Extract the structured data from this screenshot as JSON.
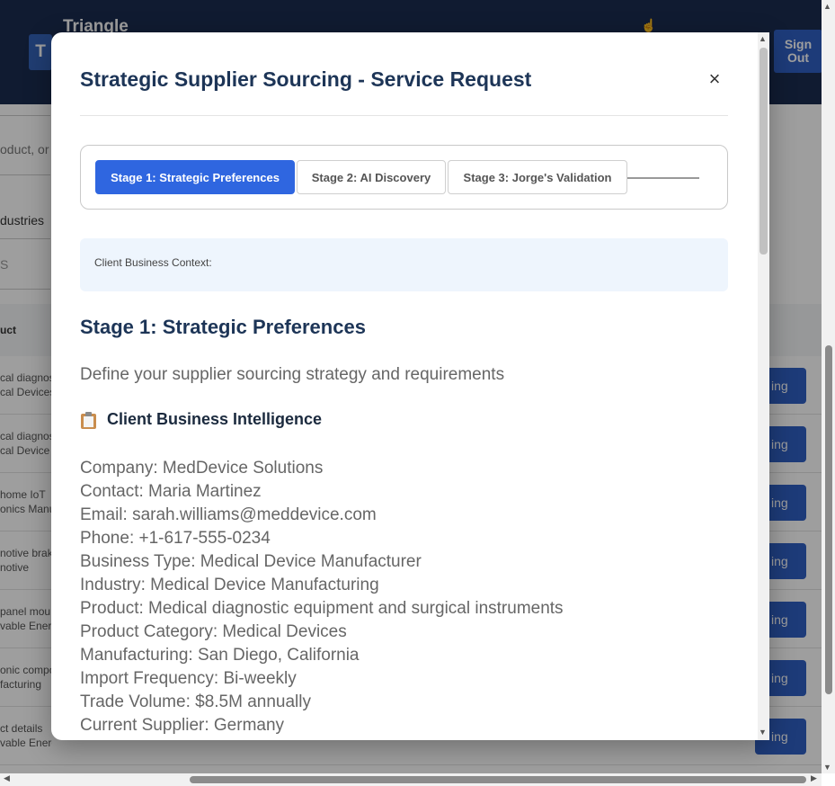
{
  "background": {
    "logo_letter": "T",
    "brand_name": "Triangle",
    "signout_label": "Sign Out",
    "search_placeholder": "oduct, or",
    "filter_label": "dustries",
    "filter_sub": "S",
    "column_header": "uct",
    "rows": [
      {
        "line1": "cal diagnos",
        "line2": "cal Devices"
      },
      {
        "line1": "cal diagnos",
        "line2": "cal Device M"
      },
      {
        "line1": " home IoT",
        "line2": "onics Manu"
      },
      {
        "line1": "notive brak",
        "line2": "notive"
      },
      {
        "line1": "panel mou",
        "line2": "vable Energ"
      },
      {
        "line1": "onic compo",
        "line2": "facturing"
      },
      {
        "line1": "ct details",
        "line2": "vable Energy"
      }
    ],
    "row_action_label": "ing"
  },
  "modal": {
    "title": "Strategic Supplier Sourcing - Service Request",
    "close_label": "×",
    "stages": [
      {
        "label": "Stage 1: Strategic Preferences"
      },
      {
        "label": "Stage 2: AI Discovery"
      },
      {
        "label": "Stage 3: Jorge's Validation"
      }
    ],
    "context_label": "Client Business Context:",
    "stage_heading": "Stage 1: Strategic Preferences",
    "stage_subtitle": "Define your supplier sourcing strategy and requirements",
    "intel_heading": "Client Business Intelligence",
    "info_lines": [
      "Company: MedDevice Solutions",
      "Contact: Maria Martinez",
      "Email: sarah.williams@meddevice.com",
      "Phone: +1-617-555-0234",
      "Business Type: Medical Device Manufacturer",
      "Industry: Medical Device Manufacturing",
      "Product: Medical diagnostic equipment and surgical instruments",
      "Product Category: Medical Devices",
      "Manufacturing: San Diego, California",
      "Import Frequency: Bi-weekly",
      "Trade Volume: $8.5M annually",
      "Current Supplier: Germany"
    ]
  },
  "colors": {
    "header_bg": "#1b2d50",
    "accent": "#2f66e0",
    "title": "#1d3557",
    "context_bg": "#eef5fd"
  }
}
